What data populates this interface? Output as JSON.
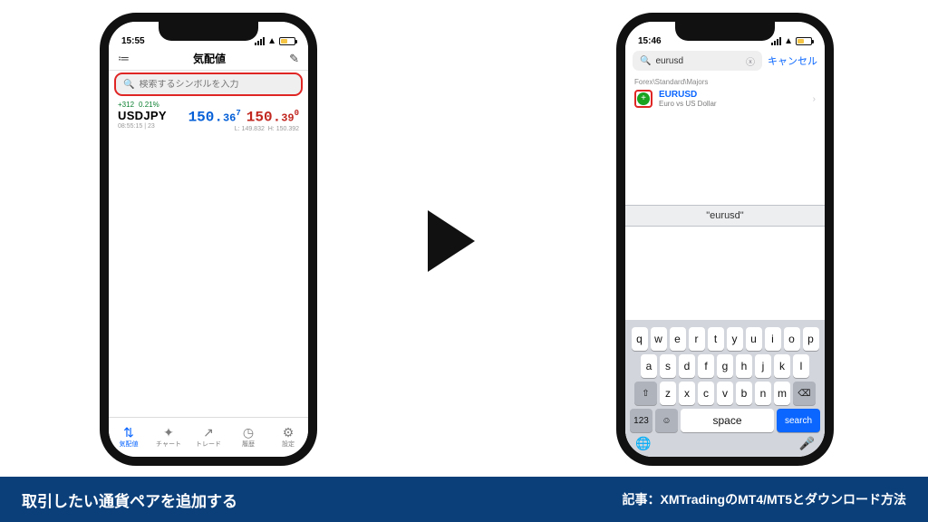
{
  "left": {
    "status_time": "15:55",
    "title": "気配値",
    "search_placeholder": "検索するシンボルを入力",
    "quote": {
      "change_pips": "+312",
      "change_pct": "0.21%",
      "symbol": "USDJPY",
      "time_spread": "08:55:15 | 23",
      "bid_big": "150.",
      "bid_pip": "36",
      "bid_frac": "7",
      "ask_big": "150.",
      "ask_pip": "39",
      "ask_frac": "0",
      "low_label": "L: 149.832",
      "high_label": "H: 150.392"
    },
    "tabs": [
      {
        "icon": "⇅",
        "label": "気配値"
      },
      {
        "icon": "✦",
        "label": "チャート"
      },
      {
        "icon": "↗",
        "label": "トレード"
      },
      {
        "icon": "◷",
        "label": "履歴"
      },
      {
        "icon": "⚙",
        "label": "設定"
      }
    ]
  },
  "right": {
    "status_time": "15:46",
    "search_value": "eurusd",
    "cancel": "キャンセル",
    "breadcrumb": "Forex\\Standard\\Majors",
    "result": {
      "name": "EURUSD",
      "desc": "Euro vs US Dollar"
    },
    "suggestion": "\"eurusd\"",
    "rows": {
      "r1": [
        "q",
        "w",
        "e",
        "r",
        "t",
        "y",
        "u",
        "i",
        "o",
        "p"
      ],
      "r2": [
        "a",
        "s",
        "d",
        "f",
        "g",
        "h",
        "j",
        "k",
        "l"
      ],
      "r3": [
        "z",
        "x",
        "c",
        "v",
        "b",
        "n",
        "m"
      ]
    },
    "shift": "⇧",
    "backspace": "⌫",
    "numkey": "123",
    "space": "space",
    "search": "search",
    "emoji": "☺",
    "mic": "🎤",
    "globe": "🌐"
  },
  "footer": {
    "left": "取引したい通貨ペアを追加する",
    "right": "記事：XMTradingのMT4/MT5とダウンロード方法"
  }
}
